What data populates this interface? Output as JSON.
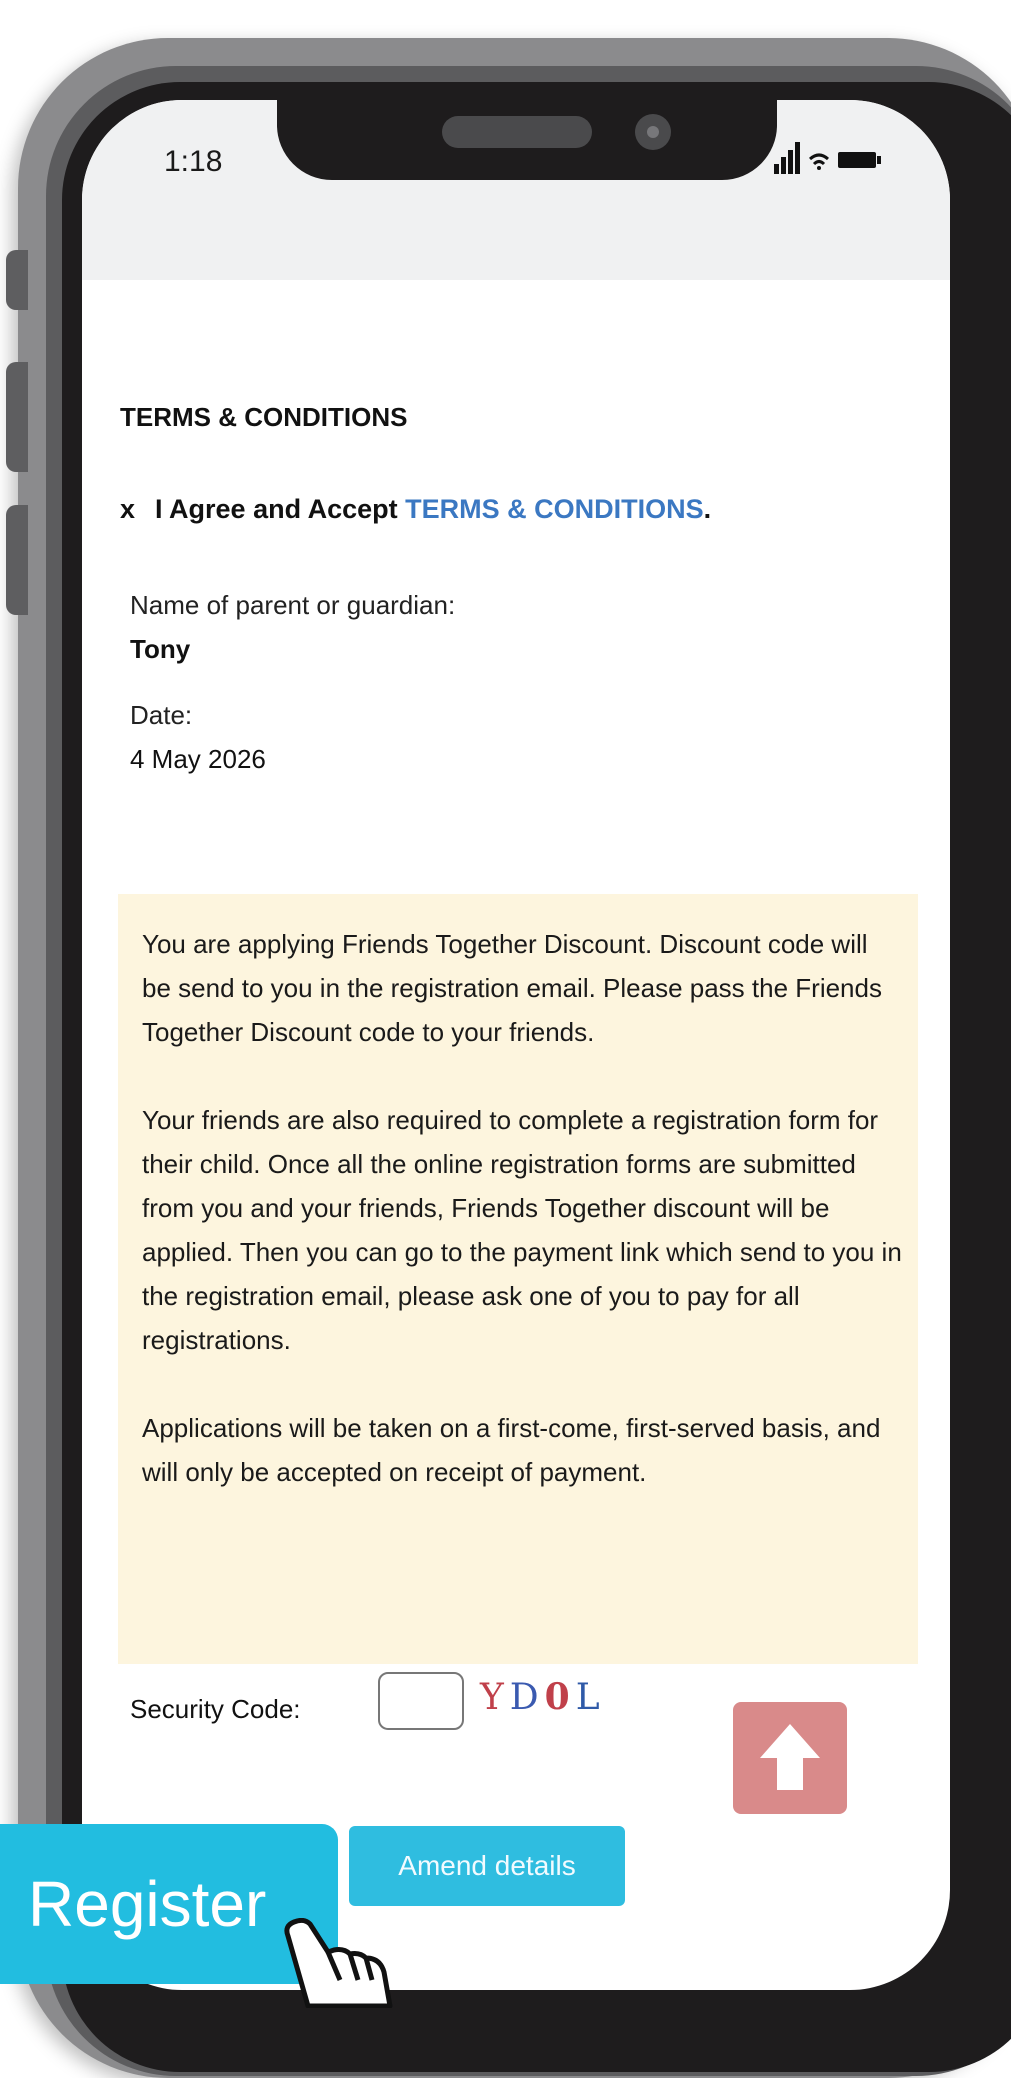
{
  "status_bar": {
    "time": "1:18"
  },
  "terms": {
    "heading": "TERMS & CONDITIONS",
    "checkbox_mark": "x",
    "agree_text": "I Agree and Accept ",
    "agree_link": "TERMS & CONDITIONS",
    "agree_period": "."
  },
  "parent": {
    "name_label": "Name of parent or guardian:",
    "name_value": "Tony",
    "date_label": "Date:",
    "date_value": "4 May 2026"
  },
  "notice": {
    "paragraph_1": "You are applying Friends Together Discount. Discount code will be send to you in the registration email. Please pass the Friends Together Discount code to your friends.",
    "paragraph_2": "Your friends are also required to complete a registration form for their child. Once all the online registration forms are submitted from you and your friends, Friends Together discount will be applied. Then you can go to the payment link which send to you in the registration email, please ask one of you to pay for all registrations.",
    "paragraph_3": "Applications will be taken on a first-come, first-served basis, and will only be accepted on receipt of payment."
  },
  "security": {
    "label": "Security Code:",
    "input_value": "",
    "captcha": [
      "Y",
      "D",
      "0",
      "L"
    ]
  },
  "buttons": {
    "amend": "Amend details",
    "register": "Register"
  },
  "icons": {
    "signal": "signal-icon",
    "wifi": "wifi-icon",
    "battery": "battery-icon",
    "scroll_top": "arrow-up-icon",
    "cursor": "hand-pointer-icon"
  },
  "colors": {
    "link": "#3b78c2",
    "notice_bg": "#fdf5de",
    "scroll_top_bg": "#d98a8a",
    "button_bg": "#22bde0"
  }
}
